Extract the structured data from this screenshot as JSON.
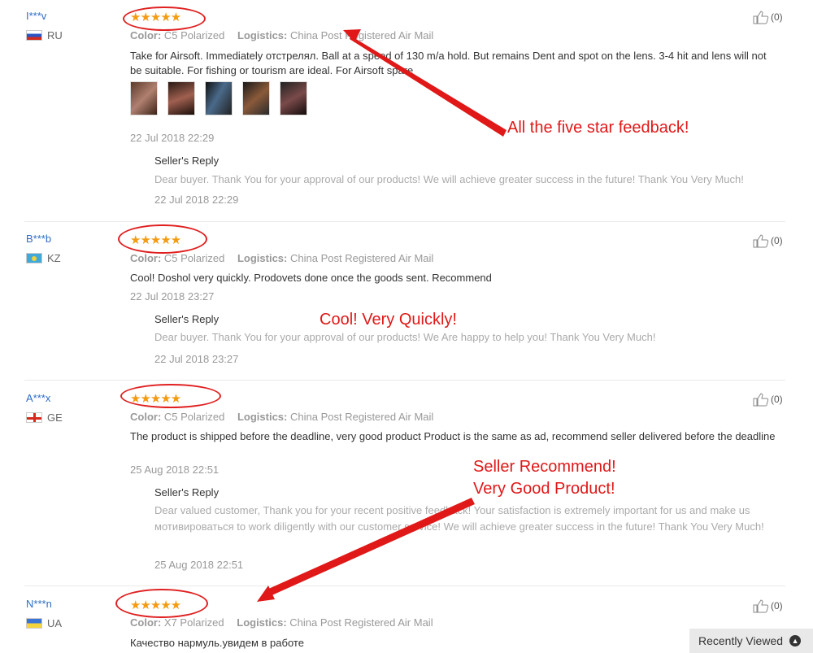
{
  "reviews": [
    {
      "username": "I***v",
      "country": "RU",
      "stars": "★★★★★",
      "color_label": "Color:",
      "color_value": "C5 Polarized",
      "logistics_label": "Logistics:",
      "logistics_value": "China Post Registered Air Mail",
      "text": "Take for Airsoft. Immediately отстрелял. Ball at a speed of 130 m/a hold. But remains Dent and spot on the lens. 3-4 hit and lens will not be suitable. For fishing or tourism are ideal. For Airsoft spare",
      "date": "22 Jul 2018 22:29",
      "reply_title": "Seller's Reply",
      "reply_text": "Dear buyer. Thank You for your approval of our products! We will achieve greater success in the future! Thank You Very Much!",
      "reply_date": "22 Jul 2018 22:29",
      "helpful": "(0)"
    },
    {
      "username": "B***b",
      "country": "KZ",
      "stars": "★★★★★",
      "color_label": "Color:",
      "color_value": "C5 Polarized",
      "logistics_label": "Logistics:",
      "logistics_value": "China Post Registered Air Mail",
      "text": "Cool! Doshol very quickly. Prodovets done once the goods sent. Recommend",
      "date": "22 Jul 2018 23:27",
      "reply_title": "Seller's Reply",
      "reply_text": "Dear buyer. Thank You for your approval of our products! We Are happy to help you! Thank You Very Much!",
      "reply_date": "22 Jul 2018 23:27",
      "helpful": "(0)"
    },
    {
      "username": "A***x",
      "country": "GE",
      "stars": "★★★★★",
      "color_label": "Color:",
      "color_value": "C5 Polarized",
      "logistics_label": "Logistics:",
      "logistics_value": "China Post Registered Air Mail",
      "text": "The product is shipped before the deadline, very good product Product is the same as ad, recommend seller delivered before the deadline",
      "date": "25 Aug 2018 22:51",
      "reply_title": "Seller's Reply",
      "reply_text": "Dear valued customer, Thank you for your recent positive feedback! Your satisfaction is extremely important for us and make us мотивироваться to work diligently with our customer service! We will achieve greater success in the future! Thank You Very Much!",
      "reply_date": "25 Aug 2018 22:51",
      "helpful": "(0)"
    },
    {
      "username": "N***n",
      "country": "UA",
      "stars": "★★★★★",
      "color_label": "Color:",
      "color_value": "X7 Polarized",
      "logistics_label": "Logistics:",
      "logistics_value": "China Post Registered Air Mail",
      "text": "Качество нармуль.увидем в работе",
      "helpful": "(0)"
    }
  ],
  "annotations": {
    "five_star": "All the five star feedback!",
    "cool": "Cool! Very Quickly!",
    "recommend_line1": "Seller Recommend!",
    "recommend_line2": "Very Good Product!"
  },
  "annotation_color": "#e01818",
  "star_color": "#f39c12",
  "username_color": "#2d6ec8",
  "recently_viewed": "Recently Viewed",
  "recently_viewed_icon": "chevron-up-icon"
}
